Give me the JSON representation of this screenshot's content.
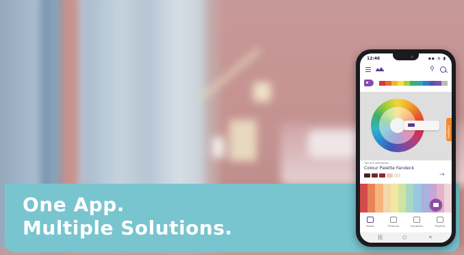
{
  "banner": {
    "line1": "One App.",
    "line2": "Multiple Solutions."
  },
  "colors": {
    "banner_teal": "#78c5cf",
    "brand_purple": "#5a3b8c",
    "accent_orange": "#f3892b",
    "wall_pink": "#c79898"
  },
  "phone": {
    "status": {
      "time": "12:46",
      "signal": "▪▪ ≋ ▮"
    },
    "appbar": {
      "menu_icon": "hamburger-icon",
      "location_icon": "location-pin-icon",
      "search_icon": "search-icon"
    },
    "swatch_strip": [
      "#d33a3a",
      "#e36d2f",
      "#f2b62d",
      "#f4e042",
      "#a7cf3a",
      "#3fb06b",
      "#2fa7b3",
      "#2f7fc6",
      "#5257b3",
      "#8a4bb0",
      "#b9b9b9"
    ],
    "side_tab": "Feedback",
    "info": {
      "kicker": "Tips and information",
      "title": "Colour Palette Fandeck",
      "chips": [
        "#4b2222",
        "#6e2b2b",
        "#8a2f2f",
        "#e8c9b9",
        "#f3e6db"
      ]
    },
    "palette_strip": [
      "#d24a4a",
      "#e8845a",
      "#f4b47a",
      "#f5d8a8",
      "#f2e7a0",
      "#cfe3a4",
      "#a9d7c1",
      "#9ac8e0",
      "#a8b1e0",
      "#c4a6d9",
      "#e3b3cc",
      "#efd4d9"
    ],
    "tabs": [
      {
        "label": "Home",
        "icon": "home-icon",
        "active": true
      },
      {
        "label": "Products",
        "icon": "products-icon",
        "active": false
      },
      {
        "label": "Visualizer",
        "icon": "camera-icon",
        "active": false
      },
      {
        "label": "Projects",
        "icon": "folder-icon",
        "active": false
      }
    ],
    "nav": {
      "recent": "|||",
      "home": "○",
      "back": "<"
    }
  }
}
